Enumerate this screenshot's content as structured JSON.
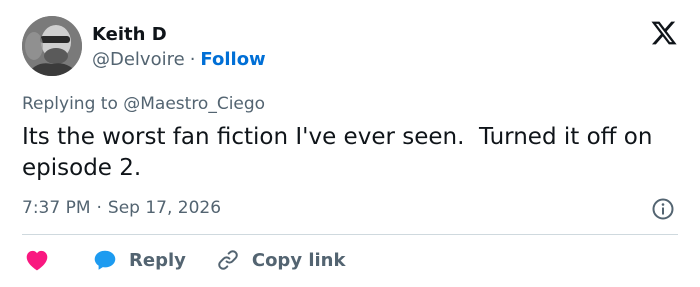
{
  "author": {
    "name": "Keith D",
    "handle": "@Delvoire",
    "separator": "·",
    "follow_label": "Follow"
  },
  "reply_context": {
    "prefix": "Replying to",
    "mention": "@Maestro_Ciego"
  },
  "tweet": {
    "text": "Its the worst fan fiction I've ever seen.  Turned it off on episode 2.",
    "time": "7:37 PM",
    "separator": "·",
    "date": "Sep 17, 2026"
  },
  "actions": {
    "like_icon": "heart-icon",
    "reply_label": "Reply",
    "reply_icon": "speech-bubble-icon",
    "copy_label": "Copy link",
    "copy_icon": "link-icon"
  },
  "icons": {
    "logo": "x-logo-icon",
    "info": "info-icon"
  },
  "colors": {
    "follow": "#006fd6",
    "heart": "#f91880",
    "reply": "#1d9bf0",
    "muted": "#536471"
  }
}
